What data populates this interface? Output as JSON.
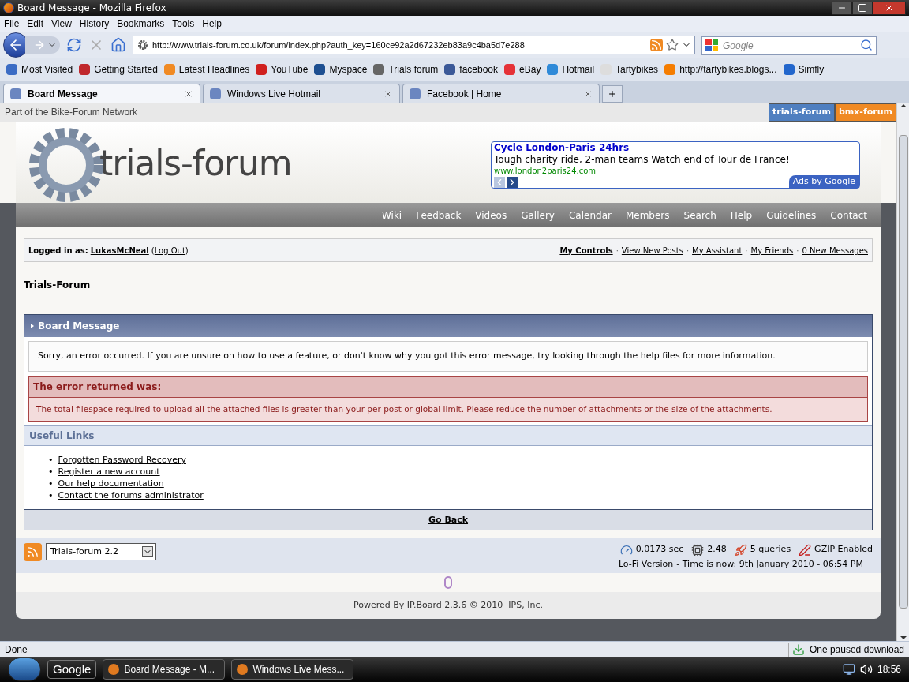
{
  "window": {
    "title": "Board Message - Mozilla Firefox"
  },
  "menu": [
    "File",
    "Edit",
    "View",
    "History",
    "Bookmarks",
    "Tools",
    "Help"
  ],
  "address": {
    "url": "http://www.trials-forum.co.uk/forum/index.php?auth_key=160ce92a2d67232eb83a9c4ba5d7e288"
  },
  "search": {
    "placeholder": "Google"
  },
  "bookmarks": [
    {
      "label": "Most Visited",
      "color": "#3b6cc4"
    },
    {
      "label": "Getting Started",
      "color": "#c0282d"
    },
    {
      "label": "Latest Headlines",
      "color": "#f08a24"
    },
    {
      "label": "YouTube",
      "color": "#d0201e"
    },
    {
      "label": "Myspace",
      "color": "#1d4f91"
    },
    {
      "label": "Trials forum",
      "color": "#666666"
    },
    {
      "label": "facebook",
      "color": "#3b5998"
    },
    {
      "label": "eBay",
      "color": "#e53238"
    },
    {
      "label": "Hotmail",
      "color": "#2f8ad8"
    },
    {
      "label": "Tartybikes",
      "color": "#dddddd"
    },
    {
      "label": "http://tartybikes.blogs...",
      "color": "#f57d00"
    },
    {
      "label": "Simfly",
      "color": "#2266cc"
    }
  ],
  "tabs": [
    {
      "label": "Board Message",
      "selected": true
    },
    {
      "label": "Windows Live Hotmail",
      "selected": false
    },
    {
      "label": "Facebook | Home",
      "selected": false
    }
  ],
  "network_bar": {
    "text": "Part of the Bike-Forum Network",
    "sites": [
      "trials-forum",
      "bmx-forum"
    ]
  },
  "logo": {
    "text": "trials-forum"
  },
  "ad": {
    "title": "Cycle London-Paris 24hrs",
    "text": "Tough charity ride, 2-man teams Watch end of Tour de France!",
    "url": "www.london2paris24.com",
    "badge": "Ads by Google"
  },
  "nav": [
    "Wiki",
    "Feedback",
    "Videos",
    "Gallery",
    "Calendar",
    "Members",
    "Search",
    "Help",
    "Guidelines",
    "Contact"
  ],
  "userbar": {
    "label": "Logged in as:",
    "user": "LukasMcNeal",
    "open": "(",
    "logout": "Log Out",
    "close": ")",
    "separator": "·",
    "links": [
      {
        "label": "My Controls",
        "bold": true
      },
      {
        "label": "View New Posts",
        "bold": false
      },
      {
        "label": "My Assistant",
        "bold": false
      },
      {
        "label": "My Friends",
        "bold": false
      },
      {
        "label": "0 New Messages",
        "bold": false
      }
    ]
  },
  "board_title": "Trials-Forum",
  "message": {
    "title": "Board Message",
    "intro": "Sorry, an error occurred. If you are unsure on how to use a feature, or don't know why you got this error message, try looking through the help files for more information.",
    "error_heading": "The error returned was:",
    "error_text": "The total filespace required to upload all the attached files is greater than your per post or global limit. Please reduce the number of attachments or the size of the attachments.",
    "links_heading": "Useful Links",
    "bullet": "•",
    "links": [
      "Forgotten Password Recovery",
      "Register a new account",
      "Our help documentation",
      "Contact the forums administrator"
    ],
    "back": "Go Back"
  },
  "footer": {
    "skin": "Trials-forum 2.2",
    "stats": [
      {
        "kind": "time",
        "text": "0.0173 sec"
      },
      {
        "kind": "load",
        "text": "2.48"
      },
      {
        "kind": "queries",
        "text": "5 queries"
      },
      {
        "kind": "gzip",
        "text": "GZIP Enabled"
      }
    ],
    "lofi": "Lo-Fi Version",
    "time": "- Time is now: 9th January 2010 - 06:54 PM",
    "powered": "Powered By IP.Board 2.3.6 © 2010  IPS, Inc."
  },
  "status_bar": {
    "text": "Done",
    "download": "One paused download"
  },
  "taskbar": {
    "google": "Google",
    "tasks": [
      "Board Message - M...",
      "Windows Live Mess..."
    ],
    "clock": "18:56"
  }
}
